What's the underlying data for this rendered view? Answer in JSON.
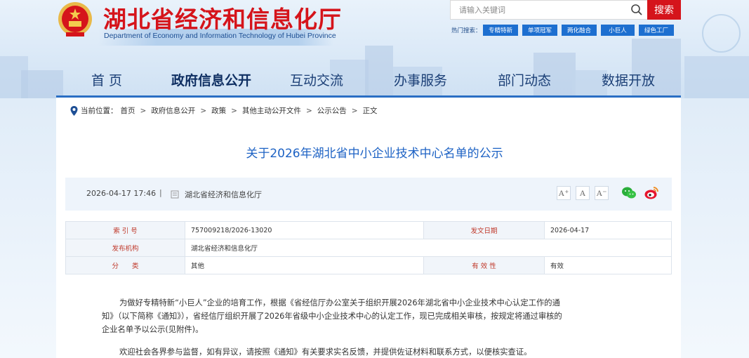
{
  "header": {
    "logo_cn": "湖北省经济和信息化厅",
    "logo_en": "Department of Economy and Information Technology of Hubei Province",
    "search_placeholder": "请输入关键词",
    "search_button": "搜索",
    "hot_label": "热门搜索：",
    "hot_tags": [
      "专精特新",
      "单项冠军",
      "两化融合",
      "小巨人",
      "绿色工厂"
    ]
  },
  "nav": {
    "items": [
      "首 页",
      "政府信息公开",
      "互动交流",
      "办事服务",
      "部门动态",
      "数据开放"
    ],
    "active_index": 1
  },
  "breadcrumb": {
    "prefix": "当前位置：",
    "items": [
      "首页",
      "政府信息公开",
      "政策",
      "其他主动公开文件",
      "公示公告",
      "正文"
    ]
  },
  "article": {
    "title": "关于2026年湖北省中小企业技术中心名单的公示",
    "datetime": "2026-04-17 17:46",
    "divider": "|",
    "publisher": "湖北省经济和信息化厅",
    "font_sizes": [
      "A⁺",
      "A",
      "A⁻"
    ],
    "share_icons": [
      "wechat-icon",
      "weibo-icon"
    ],
    "meta": {
      "index_label": "索 引 号",
      "index_value": "757009218/2026-13020",
      "date_label": "发文日期",
      "date_value": "2026-04-17",
      "org_label": "发布机构",
      "org_value": "湖北省经济和信息化厅",
      "category_label": "分　　类",
      "category_value": "其他",
      "validity_label": "有 效 性",
      "validity_value": "有效"
    },
    "body": [
      "为做好专精特新“小巨人”企业的培育工作，根据《省经信厅办公室关于组织开展2026年湖北省中小企业技术中心认定工作的通",
      "知》（以下简称《通知》），省经信厅组织开展了2026年省级中小企业技术中心的认定工作，现已完成相关审核，按规定将通过审核的",
      "企业名单予以公示(见附件)。",
      "欢迎社会各界参与监督，如有异议，请按照《通知》有关要求实名反馈，并提供佐证材料和联系方式，以便核实查证。"
    ]
  },
  "colors": {
    "brand_red": "#d5141b",
    "title_blue": "#1d62c4",
    "nav_blue": "#1b3f76",
    "tag_blue": "#1d6fd0"
  }
}
